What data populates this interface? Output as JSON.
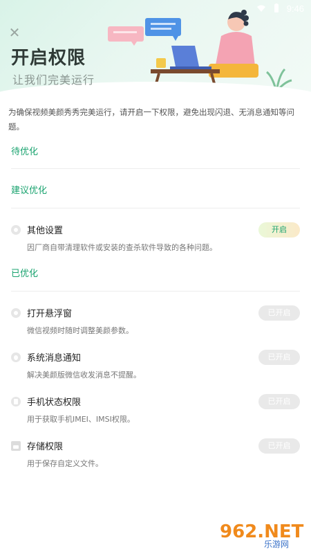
{
  "status_bar": {
    "time": "9:46"
  },
  "header": {
    "title": "开启权限",
    "subtitle": "让我们完美运行"
  },
  "intro": "为确保视频美颜秀秀完美运行，请开启一下权限，避免出现闪退、无消息通知等问题。",
  "sections": {
    "pending": "待优化",
    "suggested": "建议优化",
    "optimized": "已优化"
  },
  "suggested_items": [
    {
      "title": "其他设置",
      "desc": "因厂商自带清理软件或安装的查杀软件导致的各种问题。",
      "action": "开启",
      "icon": "gear-icon"
    }
  ],
  "optimized_items": [
    {
      "title": "打开悬浮窗",
      "desc": "微信视频时随时调整美颜参数。",
      "action": "已开启",
      "icon": "window-icon"
    },
    {
      "title": "系统消息通知",
      "desc": "解决美颜版微信收发消息不提醒。",
      "action": "已开启",
      "icon": "bell-icon"
    },
    {
      "title": "手机状态权限",
      "desc": "用于获取手机IMEI、IMSI权限。",
      "action": "已开启",
      "icon": "phone-icon"
    },
    {
      "title": "存储权限",
      "desc": "用于保存自定义文件。",
      "action": "已开启",
      "icon": "folder-icon"
    }
  ],
  "watermark": {
    "brand": "962.NET",
    "sub": "乐游网"
  },
  "colors": {
    "accent": "#1aa36f",
    "header_bg": "#e2f5ec",
    "pill_disabled": "#e9e9e9"
  }
}
